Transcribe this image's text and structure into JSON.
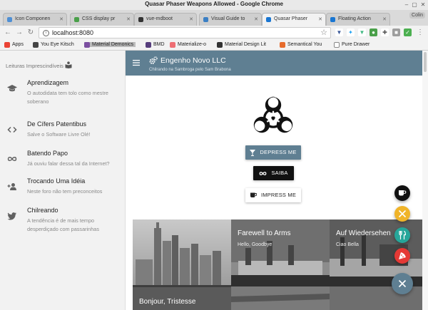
{
  "window": {
    "title": "Quasar Phaser Weapons Allowed - Google Chrome"
  },
  "tabs": [
    {
      "label": "Icon Componen",
      "color": "#4f8fd4"
    },
    {
      "label": "CSS display pr",
      "color": "#4aa04a"
    },
    {
      "label": "vue-mdboot",
      "color": "#333333"
    },
    {
      "label": "Visual Guide to",
      "color": "#3b7fc4"
    },
    {
      "label": "Quasar Phaser",
      "color": "#1976d2"
    },
    {
      "label": "Floating Action",
      "color": "#1976d2"
    }
  ],
  "profile": {
    "label": "Colin"
  },
  "address": {
    "url": "localhost:8080"
  },
  "bookmarks": [
    {
      "label": "Apps",
      "color": "#ea4335"
    },
    {
      "label": "You Eye Kitsch",
      "color": "#444444"
    },
    {
      "label": "Material Demonics",
      "color": "#7b4fa0"
    },
    {
      "label": "BMD",
      "color": "#563d7c"
    },
    {
      "label": "Materialize-o",
      "color": "#ee6e73"
    },
    {
      "label": "Material Design Lit",
      "color": "#333333"
    },
    {
      "label": "Semantical You",
      "color": "#e66b2c"
    },
    {
      "label": "Pure Drawer",
      "color": "#888888"
    }
  ],
  "drawer": {
    "header": "Leituras Imprescindíveis",
    "items": [
      {
        "label": "Aprendizagem",
        "caption": "O autodidata tem tolo como mestre soberano",
        "icon": "graduation-cap-icon"
      },
      {
        "label": "De Cífers Patentibus",
        "caption": "Salve o Software Livre Olé!",
        "icon": "code-icon"
      },
      {
        "label": "Batendo Papo",
        "caption": "Já ouviu falar dessa tal da Internet?",
        "icon": "infinity-icon"
      },
      {
        "label": "Trocando Uma Idéia",
        "caption": "Neste foro não tem preconceitos",
        "icon": "user-plus-icon"
      },
      {
        "label": "Chilreando",
        "caption": "A tendência é de mais tempo desperdiçado com passarinhas",
        "icon": "twitter-icon"
      }
    ]
  },
  "header": {
    "title": "Engenho Novo LLC",
    "subtitle": "Chilrando na Sambroga pelo Sam Brabona"
  },
  "buttons": {
    "depress": "DEPRESS ME",
    "saiba": "SAIBA",
    "impress": "IMPRESS ME"
  },
  "carousel": [
    {
      "title": "",
      "subtitle": "",
      "bottom": "Bonjour, Tristesse"
    },
    {
      "title": "Farewell to Arms",
      "subtitle": "Hello, Goodbye",
      "bottom": ""
    },
    {
      "title": "Auf Wiedersehen",
      "subtitle": "Ciao Bella",
      "bottom": ""
    }
  ],
  "fabs": [
    {
      "name": "coffee-icon",
      "color": "#111111"
    },
    {
      "name": "utensils-cross-icon",
      "color": "#f0b429"
    },
    {
      "name": "cutlery-icon",
      "color": "#26a69a"
    },
    {
      "name": "pizza-icon",
      "color": "#e53935"
    },
    {
      "name": "close-icon",
      "color": "#5f7f92"
    }
  ],
  "colors": {
    "primary": "#5f7f92",
    "dark": "#111111",
    "drawer_bg": "#f2f2f2"
  }
}
